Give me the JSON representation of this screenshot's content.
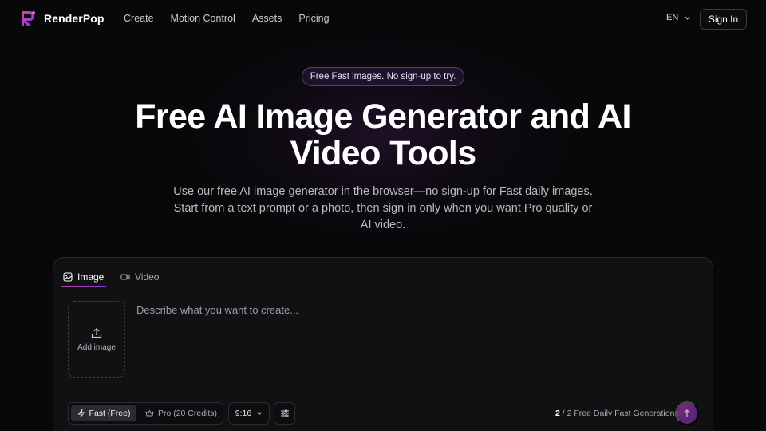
{
  "brand": {
    "name": "RenderPop",
    "icon": "renderpop-logo"
  },
  "nav": {
    "items": [
      "Create",
      "Motion Control",
      "Assets",
      "Pricing"
    ]
  },
  "header": {
    "language": "EN",
    "sign_in": "Sign In"
  },
  "hero": {
    "badge": "Free Fast images. No sign-up to try.",
    "title": "Free AI Image Generator and AI Video Tools",
    "subtitle": "Use our free AI image generator in the browser—no sign-up for Fast daily images. Start from a text prompt or a photo, then sign in only when you want Pro quality or AI video."
  },
  "composer": {
    "tabs": [
      {
        "label": "Image",
        "icon": "image-icon",
        "active": true
      },
      {
        "label": "Video",
        "icon": "video-icon",
        "active": false
      }
    ],
    "upload_label": "Add image",
    "prompt_placeholder": "Describe what you want to create...",
    "modes": [
      {
        "label": "Fast (Free)",
        "icon": "bolt-icon",
        "active": true
      },
      {
        "label": "Pro (20 Credits)",
        "icon": "crown-icon",
        "active": false
      }
    ],
    "aspect_ratio": "9:16",
    "generations": {
      "remaining": "2",
      "rest": " / 2 Free Daily Fast Generations"
    }
  },
  "colors": {
    "accent_start": "#c0399a",
    "accent_end": "#7b3fe4",
    "background": "#08080a"
  }
}
